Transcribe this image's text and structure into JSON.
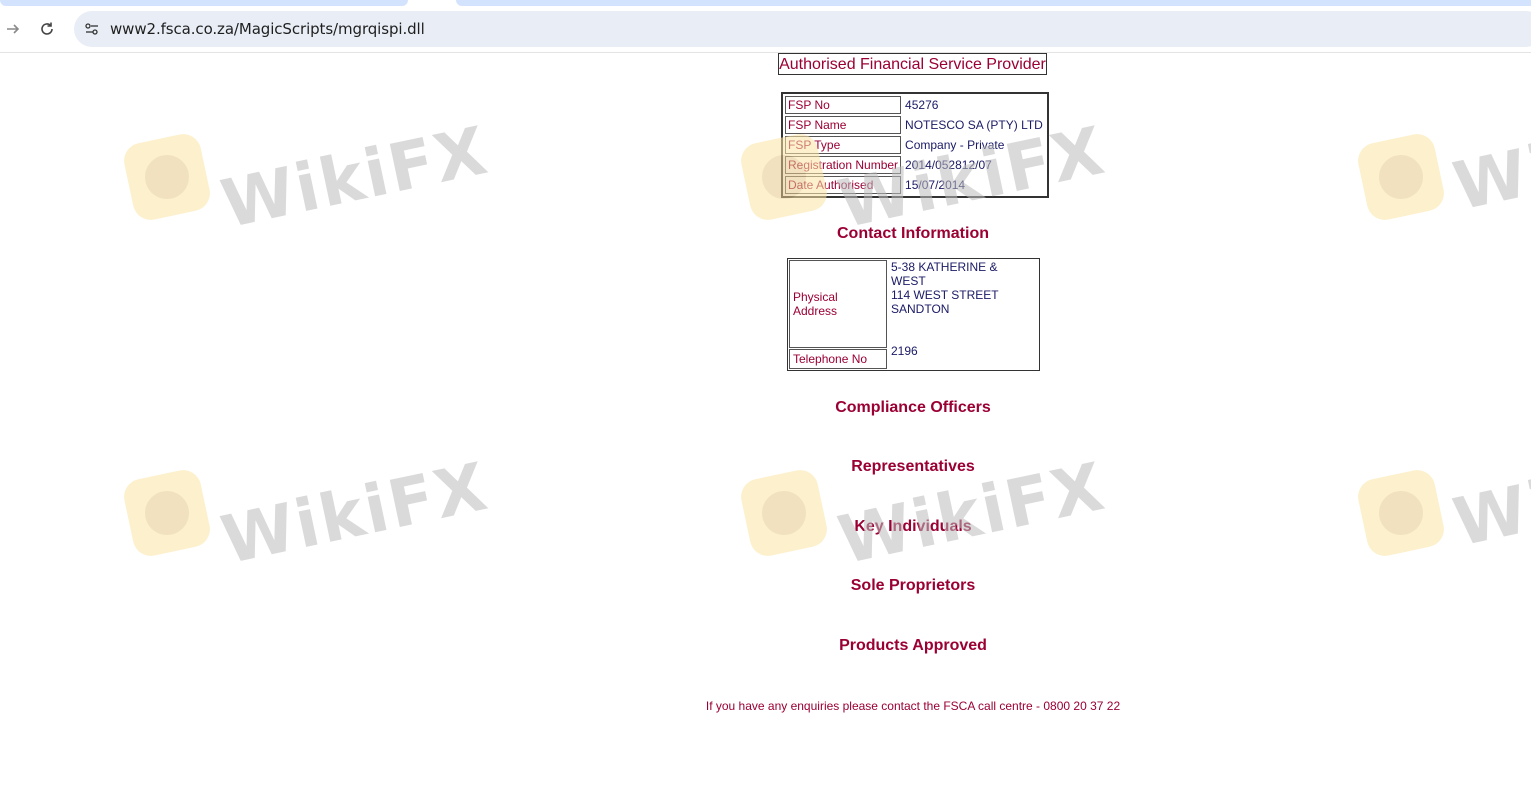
{
  "browser": {
    "url": "www2.fsca.co.za/MagicScripts/mgrqispi.dll",
    "icons": {
      "forward": "forward-arrow-icon",
      "reload": "reload-icon",
      "site_info": "site-settings-icon"
    }
  },
  "page": {
    "title": "Authorised Financial Service Provider",
    "details": [
      {
        "label": "FSP No",
        "value": "45276"
      },
      {
        "label": "FSP Name",
        "value": "NOTESCO SA (PTY) LTD"
      },
      {
        "label": "FSP Type",
        "value": "Company - Private"
      },
      {
        "label": "Registration Number",
        "value": "2014/052812/07"
      },
      {
        "label": "Date Authorised",
        "value": "15/07/2014"
      }
    ],
    "contact_heading": "Contact Information",
    "contact": {
      "address_label": "Physical Address",
      "address_line1": "5-38 KATHERINE & WEST",
      "address_line2": "114 WEST STREET",
      "address_line3": "SANDTON",
      "postal_code": "2196",
      "telephone_label": "Telephone No",
      "telephone_value": ""
    },
    "sections": [
      "Compliance Officers",
      "Representatives",
      "Key Individuals",
      "Sole Proprietors",
      "Products Approved"
    ],
    "footer": "If you have any enquiries please contact the FSCA call centre - 0800 20 37 22"
  },
  "watermark": {
    "text": "WikiFX",
    "text_short": "Wi"
  },
  "colors": {
    "accent": "#9b0033",
    "value_text": "#1a1a66",
    "omnibox": "#e9eef6"
  }
}
